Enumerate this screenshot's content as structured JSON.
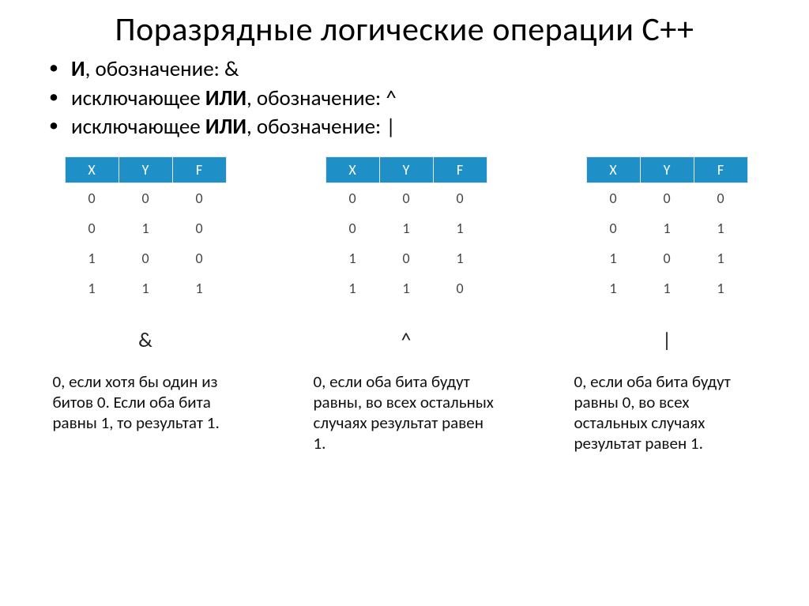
{
  "title": "Поразрядные логические операции С++",
  "bullets": [
    {
      "strong": "И",
      "rest": ", обозначение: &"
    },
    {
      "prefix": "исключающее ",
      "strong": "ИЛИ",
      "rest": ", обозначение:  ^"
    },
    {
      "prefix": "исключающее ",
      "strong": "ИЛИ",
      "rest": ", обозначение:  |"
    }
  ],
  "tables": {
    "headers": [
      "X",
      "Y",
      "F"
    ],
    "and": [
      [
        0,
        0,
        0
      ],
      [
        0,
        1,
        0
      ],
      [
        1,
        0,
        0
      ],
      [
        1,
        1,
        1
      ]
    ],
    "xor": [
      [
        0,
        0,
        0
      ],
      [
        0,
        1,
        1
      ],
      [
        1,
        0,
        1
      ],
      [
        1,
        1,
        0
      ]
    ],
    "or": [
      [
        0,
        0,
        0
      ],
      [
        0,
        1,
        1
      ],
      [
        1,
        0,
        1
      ],
      [
        1,
        1,
        1
      ]
    ]
  },
  "ops": {
    "and": "&",
    "xor": "^",
    "or": "|"
  },
  "descs": {
    "and": "0, если хотя бы один из битов 0. Если оба бита равны 1, то результат 1.",
    "xor": "0, если оба бита будут равны, во всех остальных случаях результат равен 1.",
    "or": "0, если оба бита будут равны 0, во всех остальных случаях результат равен 1."
  }
}
